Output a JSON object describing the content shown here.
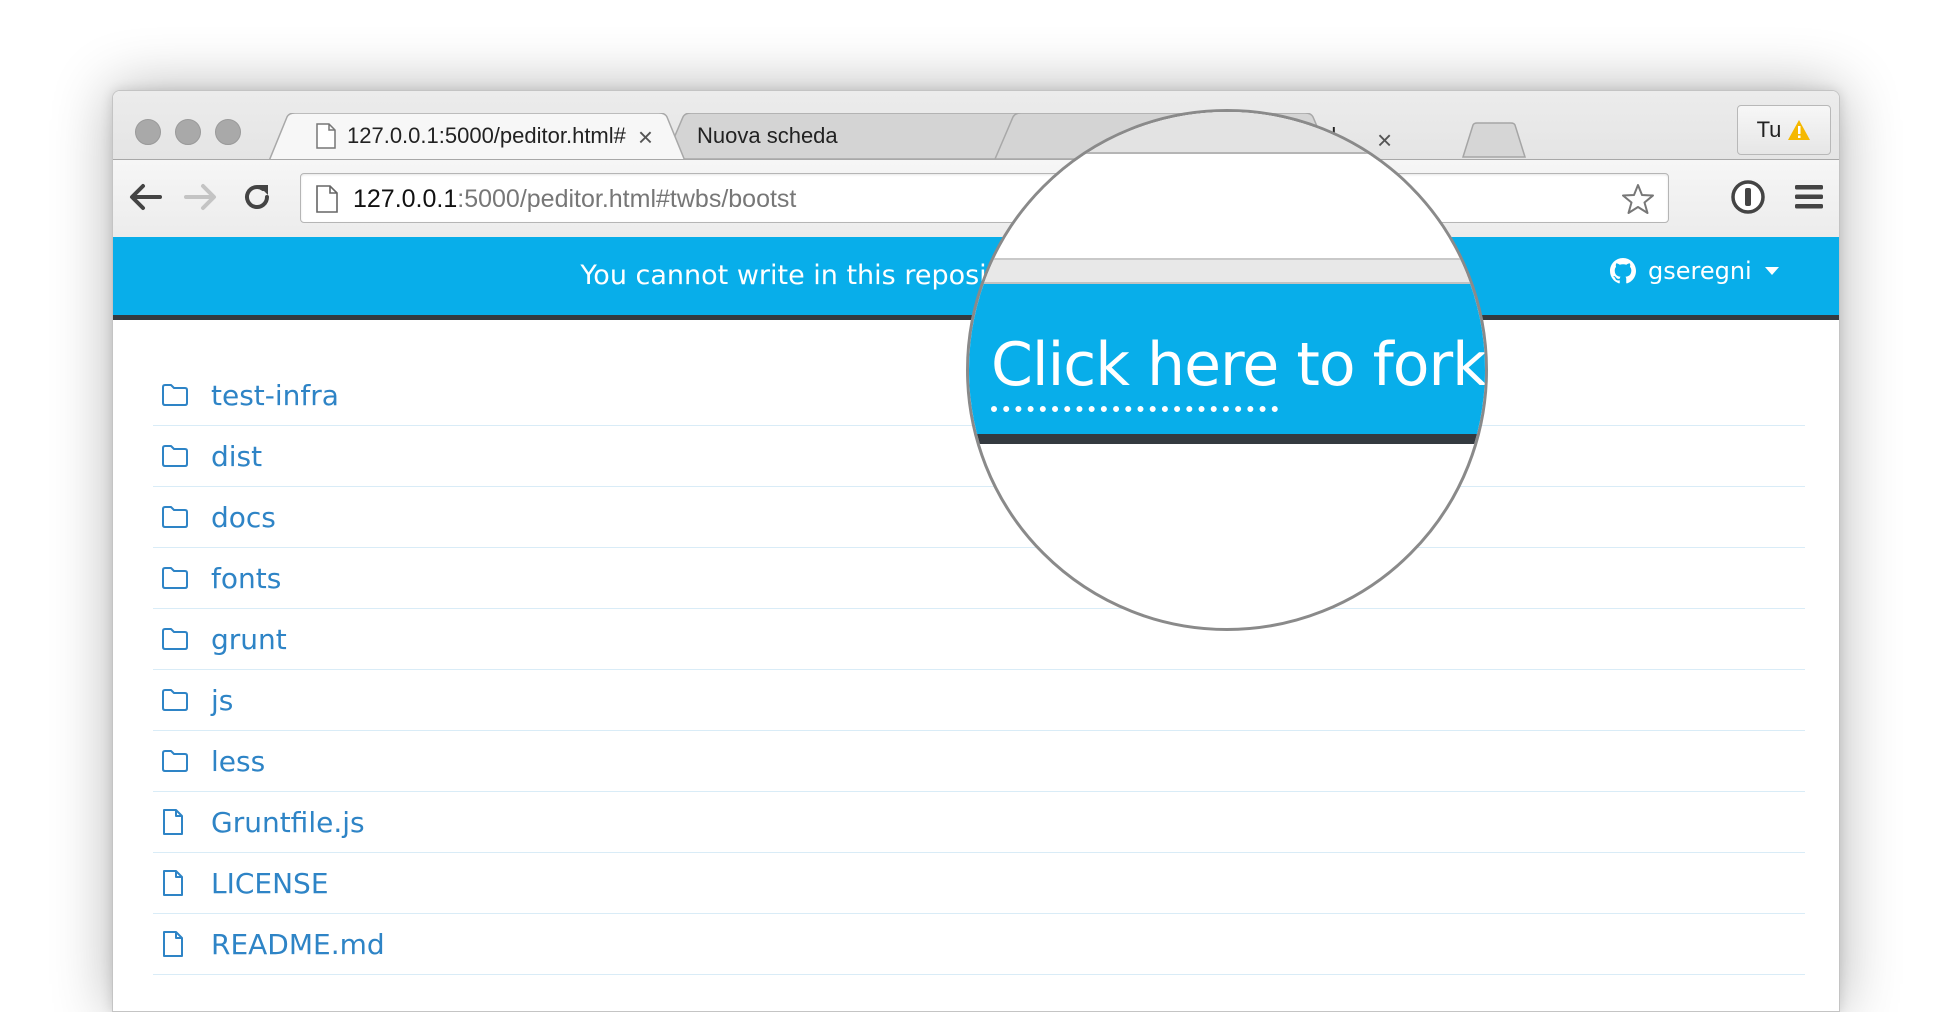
{
  "browser": {
    "tabs": [
      {
        "label": "127.0.0.1:5000/peditor.html#",
        "close": "×",
        "active": true
      },
      {
        "label": "Nuova scheda",
        "close": "",
        "active": false
      },
      {
        "label": "ml",
        "close": "×",
        "active": false
      }
    ],
    "profile_label": "Tu",
    "address": {
      "host": "127.0.0.1",
      "rest": ":5000/peditor.html#twbs/bootst"
    }
  },
  "banner": {
    "message": "You cannot write in this repository.",
    "user": "gseregni"
  },
  "magnifier": {
    "link_part1": "Click here",
    "link_part2": " to fork"
  },
  "listing": {
    "items": [
      {
        "type": "folder",
        "name": "test-infra"
      },
      {
        "type": "folder",
        "name": "dist"
      },
      {
        "type": "folder",
        "name": "docs"
      },
      {
        "type": "folder",
        "name": "fonts"
      },
      {
        "type": "folder",
        "name": "grunt"
      },
      {
        "type": "folder",
        "name": "js"
      },
      {
        "type": "folder",
        "name": "less"
      },
      {
        "type": "file",
        "name": "Gruntfile.js"
      },
      {
        "type": "file",
        "name": "LICENSE"
      },
      {
        "type": "file",
        "name": "README.md"
      }
    ]
  },
  "icons": {
    "back": "arrow-left-icon",
    "forward": "arrow-right-icon",
    "reload": "reload-icon",
    "bookmark": "star-icon",
    "password_manager": "key-circle-icon",
    "menu": "hamburger-menu-icon",
    "folder": "folder-icon",
    "file": "file-icon",
    "github": "github-icon",
    "warning": "warning-icon"
  },
  "colors": {
    "banner": "#08aeea",
    "banner_border": "#343a40",
    "link": "#2e84c6",
    "row_divider": "#d9ecf7"
  }
}
